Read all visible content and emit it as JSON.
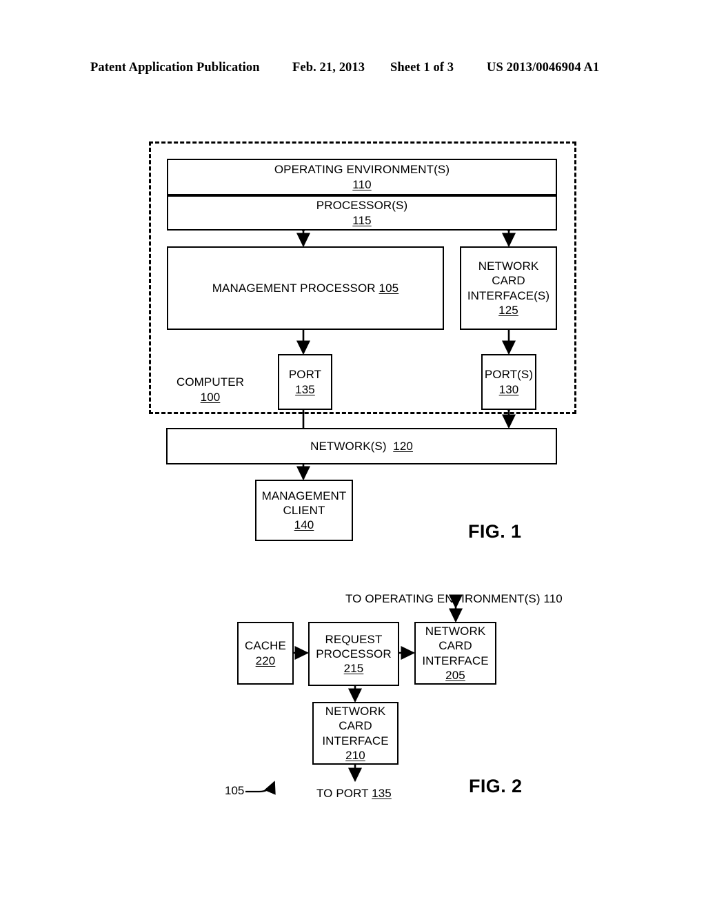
{
  "header": {
    "title": "Patent Application Publication",
    "date": "Feb. 21, 2013",
    "sheet": "Sheet 1 of 3",
    "publication_number": "US 2013/0046904 A1"
  },
  "figures": [
    {
      "label": "FIG. 1",
      "enclosure": {
        "name": "COMPUTER",
        "ref": "100"
      },
      "blocks": [
        {
          "name": "OPERATING ENVIRONMENT(S)",
          "ref": "110",
          "ref_inline": false
        },
        {
          "name": "PROCESSOR(S)",
          "ref": "115",
          "ref_inline": false
        },
        {
          "name": "MANAGEMENT PROCESSOR",
          "ref": "105",
          "ref_inline": true
        },
        {
          "name": "NETWORK CARD INTERFACE(S)",
          "ref": "125",
          "ref_inline": false
        },
        {
          "name": "PORT",
          "ref": "135",
          "ref_inline": false
        },
        {
          "name": "PORT(S)",
          "ref": "130",
          "ref_inline": false
        },
        {
          "name": "NETWORK(S)",
          "ref": "120",
          "ref_inline": true
        },
        {
          "name": "MANAGEMENT CLIENT",
          "ref": "140",
          "ref_inline": false
        }
      ]
    },
    {
      "label": "FIG. 2",
      "lead_ref": "105",
      "blocks": [
        {
          "name": "CACHE",
          "ref": "220",
          "ref_inline": false
        },
        {
          "name": "REQUEST PROCESSOR",
          "ref": "215",
          "ref_inline": false
        },
        {
          "name": "NETWORK CARD INTERFACE",
          "ref": "205",
          "ref_inline": false
        },
        {
          "name": "NETWORK CARD INTERFACE",
          "ref": "210",
          "ref_inline": false
        }
      ],
      "annotations": [
        {
          "text_prefix": "TO OPERATING ENVIRONMENT(S) 110",
          "ref": "",
          "underline": false
        },
        {
          "text_prefix": "TO PORT ",
          "ref": "135",
          "underline": true
        }
      ]
    }
  ],
  "fig1": {
    "operating_env_name": "OPERATING ENVIRONMENT(S)",
    "operating_env_ref": "110",
    "processor_name": "PROCESSOR(S)",
    "processor_ref": "115",
    "mgmt_processor_name": "MANAGEMENT PROCESSOR",
    "mgmt_processor_ref": "105",
    "nci_line1": "NETWORK",
    "nci_line2": "CARD",
    "nci_line3": "INTERFACE(S)",
    "nci_ref": "125",
    "port135_name": "PORT",
    "port135_ref": "135",
    "ports130_name": "PORT(S)",
    "ports130_ref": "130",
    "computer_name": "COMPUTER",
    "computer_ref": "100",
    "networks_name": "NETWORK(S)",
    "networks_ref": "120",
    "mgmt_client_line1": "MANAGEMENT",
    "mgmt_client_line2": "CLIENT",
    "mgmt_client_ref": "140",
    "fig_label": "FIG. 1"
  },
  "fig2": {
    "to_operating_env": "TO OPERATING ENVIRONMENT(S) 110",
    "cache_name": "CACHE",
    "cache_ref": "220",
    "request_proc_line1": "REQUEST",
    "request_proc_line2": "PROCESSOR",
    "request_proc_ref": "215",
    "nci205_line1": "NETWORK",
    "nci205_line2": "CARD",
    "nci205_line3": "INTERFACE",
    "nci205_ref": "205",
    "nci210_line1": "NETWORK",
    "nci210_line2": "CARD",
    "nci210_line3": "INTERFACE",
    "nci210_ref": "210",
    "to_port_prefix": "TO PORT ",
    "to_port_ref": "135",
    "lead_ref": "105",
    "fig_label": "FIG. 2"
  },
  "colors": {
    "ink": "#000000",
    "paper": "#ffffff"
  }
}
